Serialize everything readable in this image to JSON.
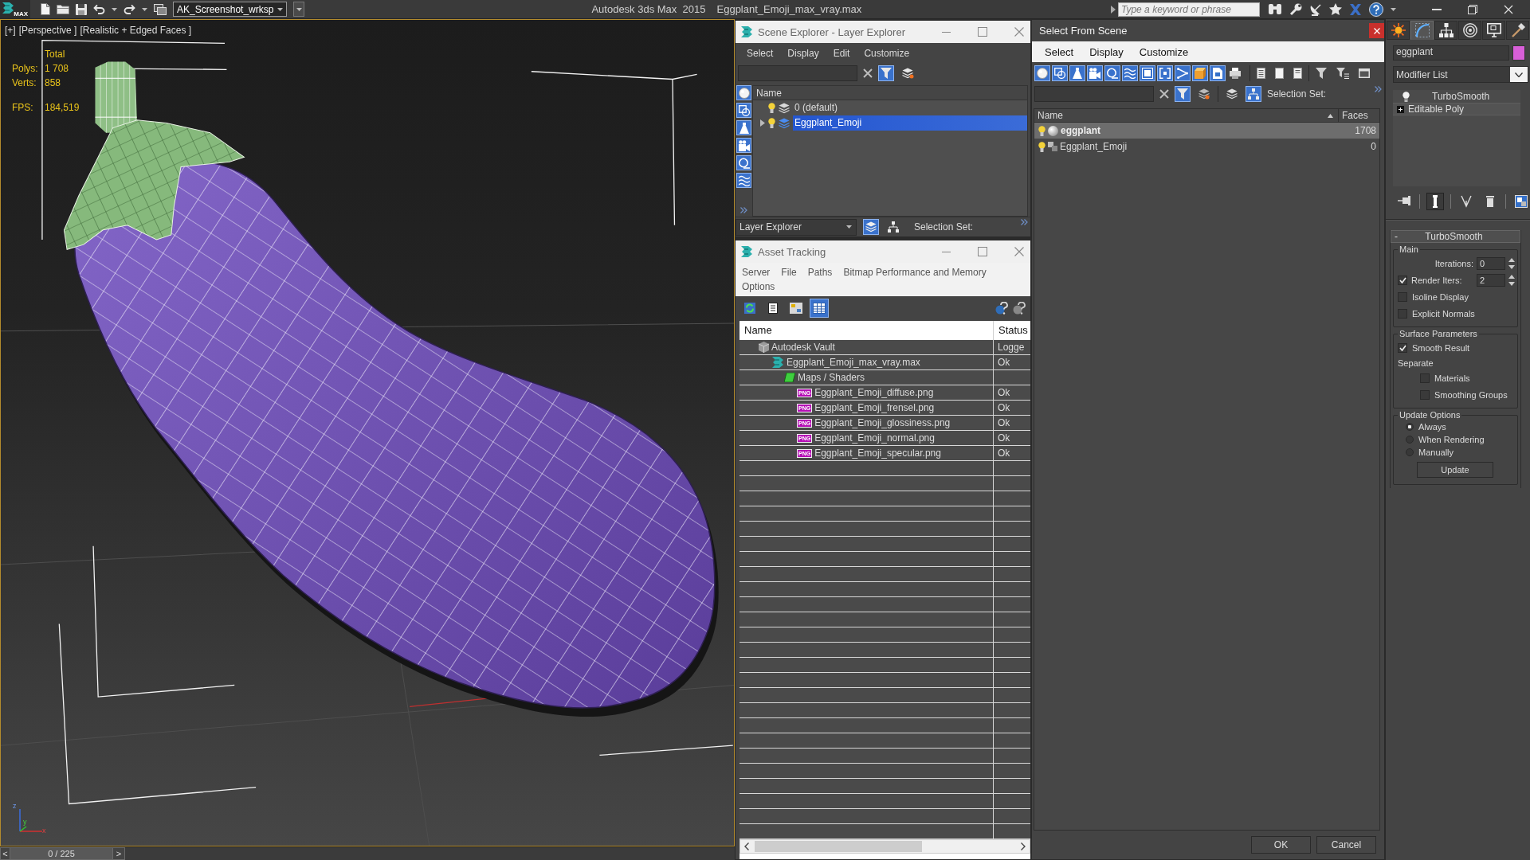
{
  "title_bar": {
    "logo": "MAX",
    "workspace": "AK_Screenshot_wrksp",
    "app_name": "Autodesk 3ds Max  2015",
    "document": "Eggplant_Emoji_max_vray.max",
    "search": {
      "placeholder": "Type a keyword or phrase"
    }
  },
  "viewport": {
    "labels": [
      "[+]",
      "[Perspective ]",
      "[Realistic + Edged Faces ]"
    ],
    "stats": {
      "heading": "Total",
      "rows": [
        {
          "label": "Polys:",
          "value": "1 708"
        },
        {
          "label": "Verts:",
          "value": "858"
        },
        {
          "label": "FPS:",
          "value": "184,519"
        }
      ]
    },
    "axis_labels": [
      "z",
      "y",
      "x"
    ]
  },
  "time_slider": {
    "previous": "<",
    "frame": "0 / 225",
    "next": ">",
    "level": 0
  },
  "scene_explorer": {
    "title": "Scene Explorer - Layer Explorer",
    "menu": [
      "Select",
      "Display",
      "Edit",
      "Customize"
    ],
    "toggles": [
      {
        "selected": true
      },
      {
        "selected": false
      }
    ],
    "side_toggles": [
      {
        "selected": true
      },
      {
        "selected": true
      },
      {
        "selected": true
      },
      {
        "selected": true
      },
      {
        "selected": true
      },
      {
        "selected": true
      }
    ],
    "column": "Name",
    "layers": [
      {
        "name": "0 (default)",
        "visible": true,
        "current": false,
        "has_children": false,
        "selected": false
      },
      {
        "name": "Eggplant_Emoji",
        "visible": true,
        "current": true,
        "has_children": true,
        "selected": true
      }
    ],
    "footer": {
      "explorer": "Layer Explorer",
      "toggles": [
        {
          "selected": true
        },
        {
          "selected": false
        }
      ],
      "selection_set": "Selection Set:"
    }
  },
  "asset_tracking": {
    "title": "Asset Tracking",
    "menu": [
      "Server",
      "File",
      "Paths",
      "Bitmap Performance and Memory",
      "Options"
    ],
    "views": [
      {
        "selected": false
      },
      {
        "selected": false
      },
      {
        "selected": false
      },
      {
        "selected": true
      }
    ],
    "columns": [
      "Name",
      "Status"
    ],
    "assets": [
      {
        "kind": "vault",
        "name": "Autodesk Vault",
        "status": "Logge",
        "children": [
          {
            "kind": "scene",
            "name": "Eggplant_Emoji_max_vray.max",
            "status": "Ok",
            "children": [
              {
                "kind": "folder",
                "name": "Maps / Shaders",
                "children": [
                  {
                    "kind": "image",
                    "badge": "PNG",
                    "name": "Eggplant_Emoji_diffuse.png",
                    "status": "Ok"
                  },
                  {
                    "kind": "image",
                    "badge": "PNG",
                    "name": "Eggplant_Emoji_frensel.png",
                    "status": "Ok"
                  },
                  {
                    "kind": "image",
                    "badge": "PNG",
                    "name": "Eggplant_Emoji_glossiness.png",
                    "status": "Ok"
                  },
                  {
                    "kind": "image",
                    "badge": "PNG",
                    "name": "Eggplant_Emoji_normal.png",
                    "status": "Ok"
                  },
                  {
                    "kind": "image",
                    "badge": "PNG",
                    "name": "Eggplant_Emoji_specular.png",
                    "status": "Ok"
                  }
                ]
              }
            ]
          }
        ]
      }
    ]
  },
  "select_from_scene": {
    "title": "Select From Scene",
    "menu": [
      "Select",
      "Display",
      "Customize"
    ],
    "type_filters": [
      {
        "selected": true
      },
      {
        "selected": true
      },
      {
        "selected": true
      },
      {
        "selected": true
      },
      {
        "selected": true
      },
      {
        "selected": true
      },
      {
        "selected": true
      },
      {
        "selected": true
      },
      {
        "selected": true
      },
      {
        "selected": true
      },
      {
        "selected": true
      },
      {
        "selected": false
      }
    ],
    "toggles": [
      {
        "selected": true
      },
      {
        "selected": false
      },
      {
        "selected": false
      },
      {
        "selected": true
      }
    ],
    "selection_set": "Selection Set:",
    "columns": [
      {
        "label": "Name",
        "sorted": true
      },
      {
        "label": "Faces",
        "sorted": false
      }
    ],
    "objects": [
      {
        "kind": "geometry",
        "name": "eggplant",
        "faces": "1708",
        "visible": true,
        "selected": true
      },
      {
        "kind": "layer",
        "name": "Eggplant_Emoji",
        "faces": "0",
        "visible": true,
        "selected": false
      }
    ],
    "buttons": [
      "OK",
      "Cancel"
    ]
  },
  "command_panel": {
    "tabs": [
      {
        "selected": false
      },
      {
        "selected": true
      },
      {
        "selected": false
      },
      {
        "selected": false
      },
      {
        "selected": false
      },
      {
        "selected": false
      }
    ],
    "object": {
      "name": "eggplant",
      "color": "#d85fd8"
    },
    "modifier_list": "Modifier List",
    "stack": [
      {
        "kind": "modifier",
        "name": "TurboSmooth"
      },
      {
        "kind": "base",
        "name": "Editable Poly"
      }
    ],
    "stack_tools": [
      {
        "selected": false
      },
      {
        "selected": true
      },
      {
        "selected": false
      },
      {
        "selected": false
      },
      {
        "selected": false
      }
    ],
    "rollout": {
      "sign": "-",
      "title": "TurboSmooth",
      "groups": [
        {
          "title": "Main",
          "controls": [
            {
              "kind": "spinner",
              "label": "Iterations:",
              "value": "0"
            },
            {
              "kind": "check_spinner",
              "label": "Render Iters:",
              "checked": true,
              "value": "2"
            },
            {
              "kind": "checkbox",
              "label": "Isoline Display",
              "checked": false
            },
            {
              "kind": "checkbox",
              "label": "Explicit Normals",
              "checked": false
            }
          ]
        },
        {
          "title": "Surface Parameters",
          "controls": [
            {
              "kind": "checkbox",
              "label": "Smooth Result",
              "checked": true
            },
            {
              "kind": "label",
              "label": "Separate",
              "children": [
                {
                  "kind": "checkbox",
                  "label": "Materials",
                  "checked": false
                },
                {
                  "kind": "checkbox",
                  "label": "Smoothing Groups",
                  "checked": false
                }
              ]
            }
          ]
        },
        {
          "title": "Update Options",
          "controls": [
            {
              "kind": "radio",
              "label": "Always",
              "selected": true
            },
            {
              "kind": "radio",
              "label": "When Rendering",
              "selected": false
            },
            {
              "kind": "radio",
              "label": "Manually",
              "selected": false
            },
            {
              "kind": "button",
              "label": "Update"
            }
          ]
        }
      ]
    }
  }
}
